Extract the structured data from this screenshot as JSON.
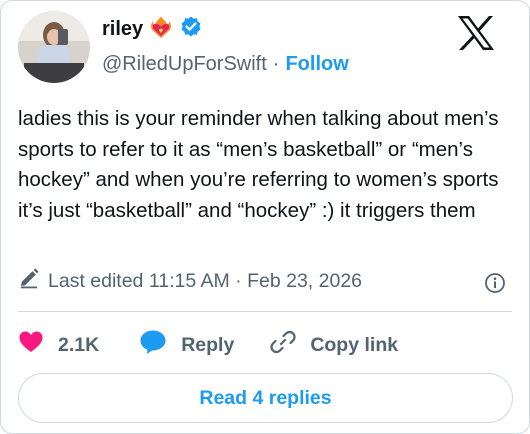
{
  "author": {
    "display_name": "riley",
    "handle": "@RiledUpForSwift",
    "separator": "·",
    "follow_label": "Follow",
    "badge_emoji": "❤️‍🔥"
  },
  "tweet": {
    "text": "ladies this is your reminder when talking about men’s sports to refer to it as “men’s basketball” or “men’s hockey” and when you’re referring to women’s sports it’s just “basketball” and “hockey” :) it triggers them",
    "edited_label": "Last edited 11:15 AM · Feb 23, 2026"
  },
  "actions": {
    "likes": "2.1K",
    "reply": "Reply",
    "copy_link": "Copy link"
  },
  "read_replies": "Read 4 replies",
  "colors": {
    "accent": "#1d9bf0",
    "heart": "#f91880",
    "muted": "#536471",
    "text": "#0f1419"
  },
  "icons": [
    "x-logo-icon",
    "verified-badge-icon",
    "pencil-icon",
    "info-icon",
    "heart-icon",
    "reply-bubble-icon",
    "link-icon"
  ]
}
